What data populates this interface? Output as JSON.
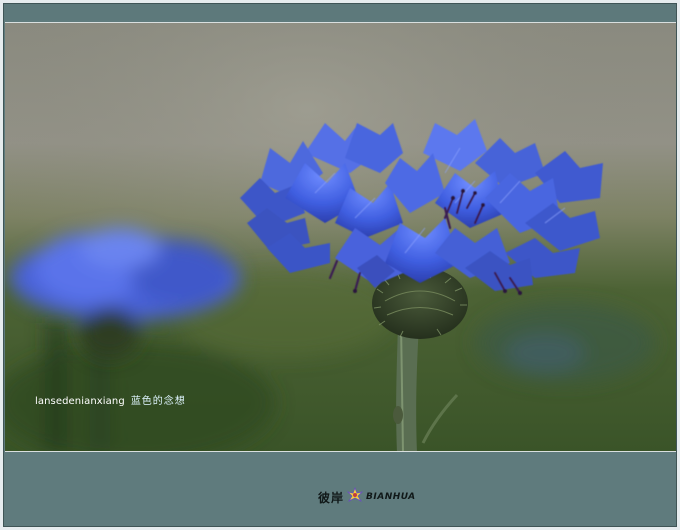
{
  "watermark": {
    "author": "lansedenianxiang",
    "author_cn": "蓝色的念想"
  },
  "logo": {
    "text_cn": "彼岸",
    "text_latin": "BIANHUA",
    "icon": "flower-logo-icon"
  },
  "colors": {
    "frame": "#5f7b7d",
    "flower_blue": "#3f5ee0",
    "background_green": "#3e5a2c",
    "background_gray": "#8d8b7e"
  }
}
